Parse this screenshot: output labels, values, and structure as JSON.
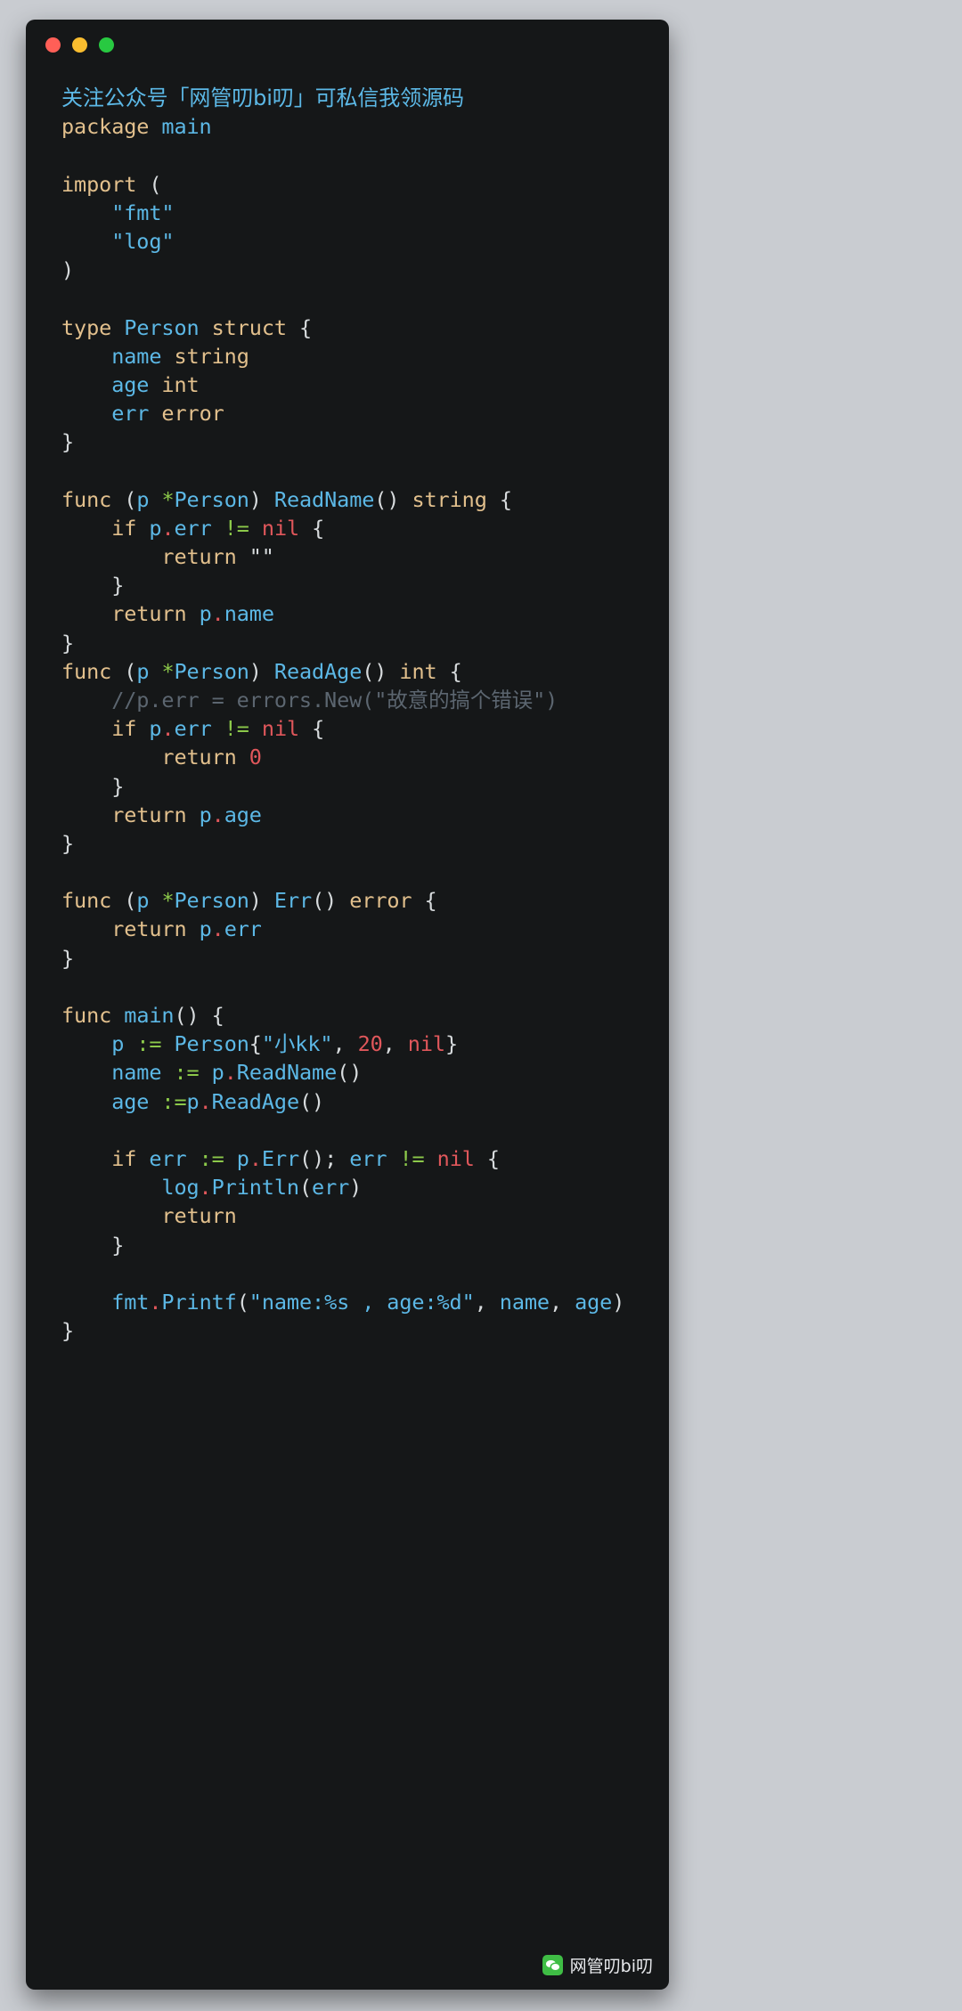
{
  "window": {
    "traffic_lights": [
      {
        "name": "close",
        "color": "#ff5f57"
      },
      {
        "name": "minimize",
        "color": "#f9bd2f"
      },
      {
        "name": "maximize",
        "color": "#28c941"
      }
    ]
  },
  "theme": {
    "background": "#151718",
    "page_background": "#c9ccd1",
    "keyword": "#e2c08d",
    "identifier": "#5cb8e6",
    "string": "#5cb8e6",
    "number": "#e0575b",
    "nil": "#e0575b",
    "operator": "#8cc94a",
    "punctuation": "#d7dbdd",
    "dot": "#e0575b",
    "comment": "#5c6670",
    "banner": "#5cb8e6"
  },
  "banner": {
    "text": "关注公众号「网管叨bi叨」可私信我领源码"
  },
  "watermark": {
    "icon": "wechat-icon",
    "text": "网管叨bi叨"
  },
  "code": {
    "language": "go",
    "plain_text": "package main\n\nimport (\n    \"fmt\"\n    \"log\"\n)\n\ntype Person struct {\n    name string\n    age int\n    err error\n}\n\nfunc (p *Person) ReadName() string {\n    if p.err != nil {\n        return \"\"\n    }\n    return p.name\n}\nfunc (p *Person) ReadAge() int {\n    //p.err = errors.New(\"故意的搞个错误\")\n    if p.err != nil {\n        return 0\n    }\n    return p.age\n}\n\nfunc (p *Person) Err() error {\n    return p.err\n}\n\nfunc main() {\n    p := Person{\"小kk\", 20, nil}\n    name := p.ReadName()\n    age :=p.ReadAge()\n\n    if err := p.Err(); err != nil {\n        log.Println(err)\n        return\n    }\n\n    fmt.Printf(\"name:%s , age:%d\", name, age)\n}",
    "lines": [
      {
        "n": 1,
        "tokens": [
          {
            "t": "package",
            "c": "kw"
          },
          {
            "t": " ",
            "c": "punc"
          },
          {
            "t": "main",
            "c": "id"
          }
        ]
      },
      {
        "n": 2,
        "tokens": []
      },
      {
        "n": 3,
        "tokens": [
          {
            "t": "import",
            "c": "kw"
          },
          {
            "t": " ",
            "c": "punc"
          },
          {
            "t": "(",
            "c": "punc"
          }
        ]
      },
      {
        "n": 4,
        "tokens": [
          {
            "t": "    ",
            "c": "punc"
          },
          {
            "t": "\"fmt\"",
            "c": "str"
          }
        ]
      },
      {
        "n": 5,
        "tokens": [
          {
            "t": "    ",
            "c": "punc"
          },
          {
            "t": "\"log\"",
            "c": "str"
          }
        ]
      },
      {
        "n": 6,
        "tokens": [
          {
            "t": ")",
            "c": "punc"
          }
        ]
      },
      {
        "n": 7,
        "tokens": []
      },
      {
        "n": 8,
        "tokens": [
          {
            "t": "type",
            "c": "kw"
          },
          {
            "t": " ",
            "c": "punc"
          },
          {
            "t": "Person",
            "c": "id"
          },
          {
            "t": " ",
            "c": "punc"
          },
          {
            "t": "struct",
            "c": "kw"
          },
          {
            "t": " ",
            "c": "punc"
          },
          {
            "t": "{",
            "c": "punc"
          }
        ]
      },
      {
        "n": 9,
        "tokens": [
          {
            "t": "    ",
            "c": "punc"
          },
          {
            "t": "name",
            "c": "id"
          },
          {
            "t": " ",
            "c": "punc"
          },
          {
            "t": "string",
            "c": "typ"
          }
        ]
      },
      {
        "n": 10,
        "tokens": [
          {
            "t": "    ",
            "c": "punc"
          },
          {
            "t": "age",
            "c": "id"
          },
          {
            "t": " ",
            "c": "punc"
          },
          {
            "t": "int",
            "c": "typ"
          }
        ]
      },
      {
        "n": 11,
        "tokens": [
          {
            "t": "    ",
            "c": "punc"
          },
          {
            "t": "err",
            "c": "id"
          },
          {
            "t": " ",
            "c": "punc"
          },
          {
            "t": "error",
            "c": "typ"
          }
        ]
      },
      {
        "n": 12,
        "tokens": [
          {
            "t": "}",
            "c": "punc"
          }
        ]
      },
      {
        "n": 13,
        "tokens": []
      },
      {
        "n": 14,
        "tokens": [
          {
            "t": "func",
            "c": "kw"
          },
          {
            "t": " (",
            "c": "punc"
          },
          {
            "t": "p",
            "c": "id"
          },
          {
            "t": " ",
            "c": "punc"
          },
          {
            "t": "*",
            "c": "op"
          },
          {
            "t": "Person",
            "c": "id"
          },
          {
            "t": ") ",
            "c": "punc"
          },
          {
            "t": "ReadName",
            "c": "id"
          },
          {
            "t": "() ",
            "c": "punc"
          },
          {
            "t": "string",
            "c": "typ"
          },
          {
            "t": " ",
            "c": "punc"
          },
          {
            "t": "{",
            "c": "punc"
          }
        ]
      },
      {
        "n": 15,
        "tokens": [
          {
            "t": "    ",
            "c": "punc"
          },
          {
            "t": "if",
            "c": "kw"
          },
          {
            "t": " ",
            "c": "punc"
          },
          {
            "t": "p",
            "c": "id"
          },
          {
            "t": ".",
            "c": "dot-op"
          },
          {
            "t": "err",
            "c": "id"
          },
          {
            "t": " ",
            "c": "punc"
          },
          {
            "t": "!=",
            "c": "op"
          },
          {
            "t": " ",
            "c": "punc"
          },
          {
            "t": "nil",
            "c": "nil"
          },
          {
            "t": " ",
            "c": "punc"
          },
          {
            "t": "{",
            "c": "punc"
          }
        ]
      },
      {
        "n": 16,
        "tokens": [
          {
            "t": "        ",
            "c": "punc"
          },
          {
            "t": "return",
            "c": "kw"
          },
          {
            "t": " ",
            "c": "punc"
          },
          {
            "t": "\"\"",
            "c": "punc"
          }
        ]
      },
      {
        "n": 17,
        "tokens": [
          {
            "t": "    ",
            "c": "punc"
          },
          {
            "t": "}",
            "c": "punc"
          }
        ]
      },
      {
        "n": 18,
        "tokens": [
          {
            "t": "    ",
            "c": "punc"
          },
          {
            "t": "return",
            "c": "kw"
          },
          {
            "t": " ",
            "c": "punc"
          },
          {
            "t": "p",
            "c": "id"
          },
          {
            "t": ".",
            "c": "dot-op"
          },
          {
            "t": "name",
            "c": "id"
          }
        ]
      },
      {
        "n": 19,
        "tokens": [
          {
            "t": "}",
            "c": "punc"
          }
        ]
      },
      {
        "n": 20,
        "tokens": [
          {
            "t": "func",
            "c": "kw"
          },
          {
            "t": " (",
            "c": "punc"
          },
          {
            "t": "p",
            "c": "id"
          },
          {
            "t": " ",
            "c": "punc"
          },
          {
            "t": "*",
            "c": "op"
          },
          {
            "t": "Person",
            "c": "id"
          },
          {
            "t": ") ",
            "c": "punc"
          },
          {
            "t": "ReadAge",
            "c": "id"
          },
          {
            "t": "() ",
            "c": "punc"
          },
          {
            "t": "int",
            "c": "typ"
          },
          {
            "t": " ",
            "c": "punc"
          },
          {
            "t": "{",
            "c": "punc"
          }
        ]
      },
      {
        "n": 21,
        "tokens": [
          {
            "t": "    ",
            "c": "punc"
          },
          {
            "t": "//p.err = errors.New(\"故意的搞个错误\")",
            "c": "cmt"
          }
        ]
      },
      {
        "n": 22,
        "tokens": [
          {
            "t": "    ",
            "c": "punc"
          },
          {
            "t": "if",
            "c": "kw"
          },
          {
            "t": " ",
            "c": "punc"
          },
          {
            "t": "p",
            "c": "id"
          },
          {
            "t": ".",
            "c": "dot-op"
          },
          {
            "t": "err",
            "c": "id"
          },
          {
            "t": " ",
            "c": "punc"
          },
          {
            "t": "!=",
            "c": "op"
          },
          {
            "t": " ",
            "c": "punc"
          },
          {
            "t": "nil",
            "c": "nil"
          },
          {
            "t": " ",
            "c": "punc"
          },
          {
            "t": "{",
            "c": "punc"
          }
        ]
      },
      {
        "n": 23,
        "tokens": [
          {
            "t": "        ",
            "c": "punc"
          },
          {
            "t": "return",
            "c": "kw"
          },
          {
            "t": " ",
            "c": "punc"
          },
          {
            "t": "0",
            "c": "num"
          }
        ]
      },
      {
        "n": 24,
        "tokens": [
          {
            "t": "    ",
            "c": "punc"
          },
          {
            "t": "}",
            "c": "punc"
          }
        ]
      },
      {
        "n": 25,
        "tokens": [
          {
            "t": "    ",
            "c": "punc"
          },
          {
            "t": "return",
            "c": "kw"
          },
          {
            "t": " ",
            "c": "punc"
          },
          {
            "t": "p",
            "c": "id"
          },
          {
            "t": ".",
            "c": "dot-op"
          },
          {
            "t": "age",
            "c": "id"
          }
        ]
      },
      {
        "n": 26,
        "tokens": [
          {
            "t": "}",
            "c": "punc"
          }
        ]
      },
      {
        "n": 27,
        "tokens": []
      },
      {
        "n": 28,
        "tokens": [
          {
            "t": "func",
            "c": "kw"
          },
          {
            "t": " (",
            "c": "punc"
          },
          {
            "t": "p",
            "c": "id"
          },
          {
            "t": " ",
            "c": "punc"
          },
          {
            "t": "*",
            "c": "op"
          },
          {
            "t": "Person",
            "c": "id"
          },
          {
            "t": ") ",
            "c": "punc"
          },
          {
            "t": "Err",
            "c": "id"
          },
          {
            "t": "() ",
            "c": "punc"
          },
          {
            "t": "error",
            "c": "typ"
          },
          {
            "t": " ",
            "c": "punc"
          },
          {
            "t": "{",
            "c": "punc"
          }
        ]
      },
      {
        "n": 29,
        "tokens": [
          {
            "t": "    ",
            "c": "punc"
          },
          {
            "t": "return",
            "c": "kw"
          },
          {
            "t": " ",
            "c": "punc"
          },
          {
            "t": "p",
            "c": "id"
          },
          {
            "t": ".",
            "c": "dot-op"
          },
          {
            "t": "err",
            "c": "id"
          }
        ]
      },
      {
        "n": 30,
        "tokens": [
          {
            "t": "}",
            "c": "punc"
          }
        ]
      },
      {
        "n": 31,
        "tokens": []
      },
      {
        "n": 32,
        "tokens": [
          {
            "t": "func",
            "c": "kw"
          },
          {
            "t": " ",
            "c": "punc"
          },
          {
            "t": "main",
            "c": "id"
          },
          {
            "t": "() ",
            "c": "punc"
          },
          {
            "t": "{",
            "c": "punc"
          }
        ]
      },
      {
        "n": 33,
        "tokens": [
          {
            "t": "    ",
            "c": "punc"
          },
          {
            "t": "p",
            "c": "id"
          },
          {
            "t": " ",
            "c": "punc"
          },
          {
            "t": ":=",
            "c": "op"
          },
          {
            "t": " ",
            "c": "punc"
          },
          {
            "t": "Person",
            "c": "id"
          },
          {
            "t": "{",
            "c": "punc"
          },
          {
            "t": "\"小kk\"",
            "c": "str"
          },
          {
            "t": ", ",
            "c": "comma"
          },
          {
            "t": "20",
            "c": "num"
          },
          {
            "t": ", ",
            "c": "comma"
          },
          {
            "t": "nil",
            "c": "nil"
          },
          {
            "t": "}",
            "c": "punc"
          }
        ]
      },
      {
        "n": 34,
        "tokens": [
          {
            "t": "    ",
            "c": "punc"
          },
          {
            "t": "name",
            "c": "id"
          },
          {
            "t": " ",
            "c": "punc"
          },
          {
            "t": ":=",
            "c": "op"
          },
          {
            "t": " ",
            "c": "punc"
          },
          {
            "t": "p",
            "c": "id"
          },
          {
            "t": ".",
            "c": "dot-op"
          },
          {
            "t": "ReadName",
            "c": "id"
          },
          {
            "t": "()",
            "c": "punc"
          }
        ]
      },
      {
        "n": 35,
        "tokens": [
          {
            "t": "    ",
            "c": "punc"
          },
          {
            "t": "age",
            "c": "id"
          },
          {
            "t": " ",
            "c": "punc"
          },
          {
            "t": ":=",
            "c": "op"
          },
          {
            "t": "p",
            "c": "id"
          },
          {
            "t": ".",
            "c": "dot-op"
          },
          {
            "t": "ReadAge",
            "c": "id"
          },
          {
            "t": "()",
            "c": "punc"
          }
        ]
      },
      {
        "n": 36,
        "tokens": []
      },
      {
        "n": 37,
        "tokens": [
          {
            "t": "    ",
            "c": "punc"
          },
          {
            "t": "if",
            "c": "kw"
          },
          {
            "t": " ",
            "c": "punc"
          },
          {
            "t": "err",
            "c": "id"
          },
          {
            "t": " ",
            "c": "punc"
          },
          {
            "t": ":=",
            "c": "op"
          },
          {
            "t": " ",
            "c": "punc"
          },
          {
            "t": "p",
            "c": "id"
          },
          {
            "t": ".",
            "c": "dot-op"
          },
          {
            "t": "Err",
            "c": "id"
          },
          {
            "t": "(); ",
            "c": "punc"
          },
          {
            "t": "err",
            "c": "id"
          },
          {
            "t": " ",
            "c": "punc"
          },
          {
            "t": "!=",
            "c": "op"
          },
          {
            "t": " ",
            "c": "punc"
          },
          {
            "t": "nil",
            "c": "nil"
          },
          {
            "t": " ",
            "c": "punc"
          },
          {
            "t": "{",
            "c": "punc"
          }
        ]
      },
      {
        "n": 38,
        "tokens": [
          {
            "t": "        ",
            "c": "punc"
          },
          {
            "t": "log",
            "c": "id"
          },
          {
            "t": ".",
            "c": "dot-op"
          },
          {
            "t": "Println",
            "c": "id"
          },
          {
            "t": "(",
            "c": "punc"
          },
          {
            "t": "err",
            "c": "id"
          },
          {
            "t": ")",
            "c": "punc"
          }
        ]
      },
      {
        "n": 39,
        "tokens": [
          {
            "t": "        ",
            "c": "punc"
          },
          {
            "t": "return",
            "c": "kw"
          }
        ]
      },
      {
        "n": 40,
        "tokens": [
          {
            "t": "    ",
            "c": "punc"
          },
          {
            "t": "}",
            "c": "punc"
          }
        ]
      },
      {
        "n": 41,
        "tokens": []
      },
      {
        "n": 42,
        "tokens": [
          {
            "t": "    ",
            "c": "punc"
          },
          {
            "t": "fmt",
            "c": "id"
          },
          {
            "t": ".",
            "c": "dot-op"
          },
          {
            "t": "Printf",
            "c": "id"
          },
          {
            "t": "(",
            "c": "punc"
          },
          {
            "t": "\"name:%s , age:%d\"",
            "c": "str"
          },
          {
            "t": ", ",
            "c": "comma"
          },
          {
            "t": "name",
            "c": "id"
          },
          {
            "t": ", ",
            "c": "comma"
          },
          {
            "t": "age",
            "c": "id"
          },
          {
            "t": ")",
            "c": "punc"
          }
        ]
      },
      {
        "n": 43,
        "tokens": [
          {
            "t": "}",
            "c": "punc"
          }
        ]
      }
    ]
  }
}
